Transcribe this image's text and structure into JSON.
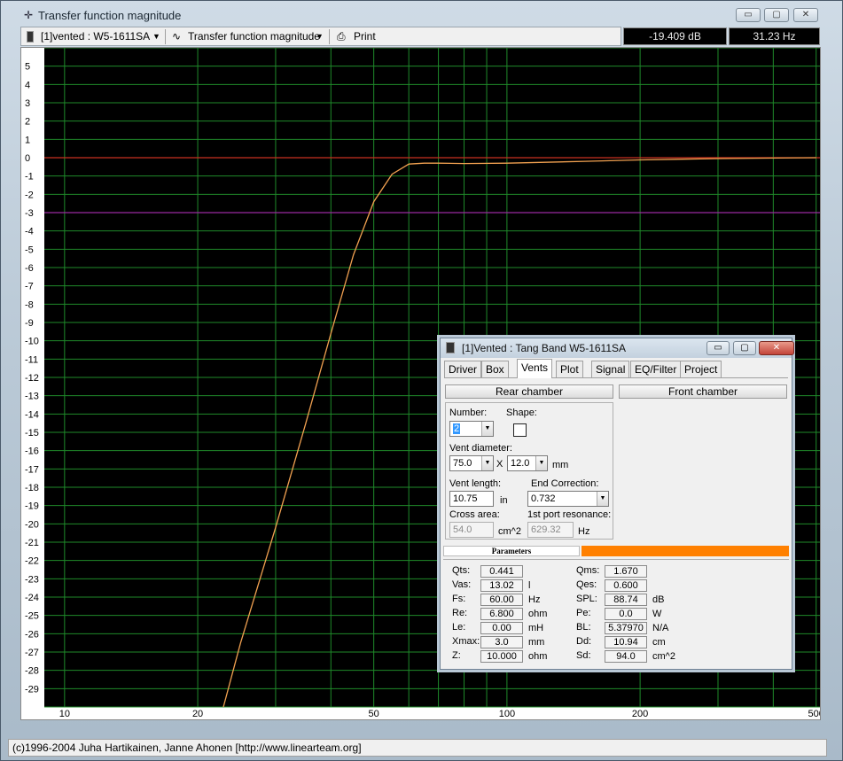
{
  "window": {
    "title": "Transfer function magnitude",
    "app_icon": "crosshair-icon",
    "caption_minimize": "▭",
    "caption_maximize": "▢",
    "caption_close": "✕"
  },
  "toolbar": {
    "project_label": "[1]vented : W5-1611SA",
    "view_label": "Transfer function magnitude",
    "print_label": "Print"
  },
  "readouts": {
    "db": "-19.409 dB",
    "hz": "31.23 Hz"
  },
  "chart_data": {
    "type": "line",
    "title": "Transfer function magnitude",
    "xscale": "log",
    "xlim": [
      9,
      510
    ],
    "ylim": [
      -30,
      6
    ],
    "x_tick_labels": [
      "10",
      "20",
      "50",
      "100",
      "200",
      "500"
    ],
    "x_ticks": [
      10,
      20,
      50,
      100,
      200,
      500
    ],
    "y_ticks": [
      5,
      4,
      3,
      2,
      1,
      0,
      -1,
      -2,
      -3,
      -4,
      -5,
      -6,
      -7,
      -8,
      -9,
      -10,
      -11,
      -12,
      -13,
      -14,
      -15,
      -16,
      -17,
      -18,
      -19,
      -20,
      -21,
      -22,
      -23,
      -24,
      -25,
      -26,
      -27,
      -28,
      -29
    ],
    "reference_lines": [
      {
        "y": 0,
        "color": "#c83020"
      },
      {
        "y": -3,
        "color": "#9a2aa0"
      }
    ],
    "background": "#000000",
    "grid_color": "#1f8a2a",
    "series": [
      {
        "color": "#f0a050",
        "x": [
          22,
          25,
          30,
          35,
          40,
          45,
          50,
          55,
          60,
          65,
          70,
          80,
          100,
          150,
          200,
          300,
          500
        ],
        "y": [
          -31.5,
          -26.5,
          -20.2,
          -14.6,
          -9.6,
          -5.3,
          -2.4,
          -0.9,
          -0.35,
          -0.3,
          -0.3,
          -0.32,
          -0.3,
          -0.2,
          -0.12,
          -0.05,
          0
        ]
      }
    ]
  },
  "dialog": {
    "title": "[1]Vented : Tang Band W5-1611SA",
    "tabs": [
      "Driver",
      "Box",
      "Vents",
      "Plot",
      "Signal",
      "EQ/Filter",
      "Project"
    ],
    "active_tab": "Vents",
    "rear_chamber": "Rear chamber",
    "front_chamber": "Front chamber",
    "number_label": "Number:",
    "number_value": "2",
    "shape_label": "Shape:",
    "vent_diameter_label": "Vent diameter:",
    "vent_diameter_value": "75.0",
    "vent_x": "X",
    "vent_second_value": "12.0",
    "vent_unit": "mm",
    "vent_length_label": "Vent length:",
    "vent_length_value": "10.75",
    "vent_length_unit": "in",
    "end_correction_label": "End Correction:",
    "end_correction_value": "0.732",
    "cross_area_label": "Cross area:",
    "cross_area_value": "54.0",
    "cross_area_unit": "cm^2",
    "port_res_label": "1st port resonance:",
    "port_res_value": "629.32",
    "port_res_unit": "Hz",
    "parameters_label": "Parameters",
    "params_left": [
      {
        "name": "Qts:",
        "value": "0.441",
        "unit": ""
      },
      {
        "name": "Vas:",
        "value": "13.02",
        "unit": "l"
      },
      {
        "name": "Fs:",
        "value": "60.00",
        "unit": "Hz"
      },
      {
        "name": "Re:",
        "value": "6.800",
        "unit": "ohm"
      },
      {
        "name": "Le:",
        "value": "0.00",
        "unit": "mH"
      },
      {
        "name": "Xmax:",
        "value": "3.0",
        "unit": "mm"
      },
      {
        "name": "Z:",
        "value": "10.000",
        "unit": "ohm"
      }
    ],
    "params_right": [
      {
        "name": "Qms:",
        "value": "1.670",
        "unit": ""
      },
      {
        "name": "Qes:",
        "value": "0.600",
        "unit": ""
      },
      {
        "name": "SPL:",
        "value": "88.74",
        "unit": "dB"
      },
      {
        "name": "Pe:",
        "value": "0.0",
        "unit": "W"
      },
      {
        "name": "BL:",
        "value": "5.37970",
        "unit": "N/A"
      },
      {
        "name": "Dd:",
        "value": "10.94",
        "unit": "cm"
      },
      {
        "name": "Sd:",
        "value": "94.0",
        "unit": "cm^2"
      }
    ]
  },
  "status": {
    "text": "(c)1996-2004 Juha Hartikainen, Janne Ahonen [http://www.linearteam.org]"
  }
}
